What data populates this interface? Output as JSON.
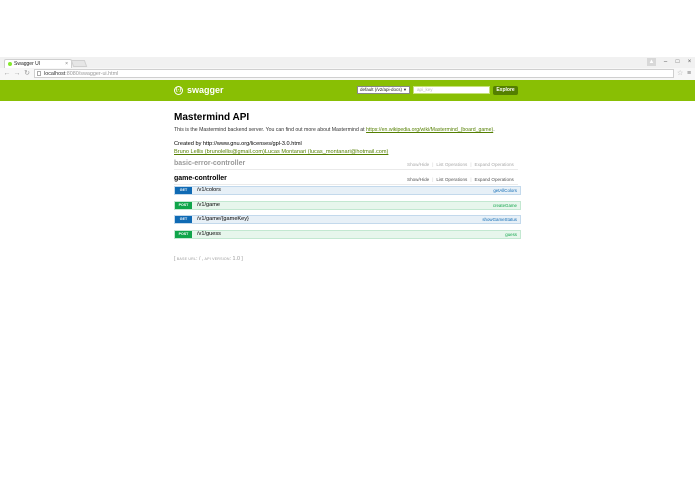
{
  "browser": {
    "tab_title": "Swagger UI",
    "tab_close": "×",
    "url_host": "localhost",
    "url_rest": ":8080/swagger-ui.html",
    "window_controls": {
      "minimize": "–",
      "maximize": "□",
      "close": "×"
    }
  },
  "header": {
    "logo_symbol": "{-}",
    "logo_text": "swagger",
    "spec_select": "default (/v2/api-docs)",
    "api_key_placeholder": "api_key",
    "explore_label": "Explore",
    "color": "#89bf04"
  },
  "info": {
    "title": "Mastermind API",
    "description_prefix": "This is the Mastermind backend server. You can find out more about Mastermind at ",
    "description_link": "https://en.wikipedia.org/wiki/Mastermind_(board_game)",
    "description_suffix": ".",
    "created_by": "Created by http://www.gnu.org/licenses/gpl-3.0.html",
    "contact_1": "Bruno Lellis (brunolellis@gmail.com)",
    "contact_2": "Lucas Montanari (lucas_montanari@hotmail.com)"
  },
  "resources": [
    {
      "name": "basic-error-controller",
      "show_hide": "Show/Hide",
      "list_operations": "List Operations",
      "expand_operations": "Expand Operations"
    },
    {
      "name": "game-controller",
      "show_hide": "Show/Hide",
      "list_operations": "List Operations",
      "expand_operations": "Expand Operations",
      "operations": [
        {
          "method": "GET",
          "path": "/v1/colors",
          "nickname": "getAllColors"
        },
        {
          "method": "POST",
          "path": "/v1/game",
          "nickname": "createGame"
        },
        {
          "method": "GET",
          "path": "/v1/game/{gameKey}",
          "nickname": "showGameStatus"
        },
        {
          "method": "POST",
          "path": "/v1/guess",
          "nickname": "guess"
        }
      ]
    }
  ],
  "footer": {
    "base_url_label": "BASE URL",
    "base_url": "/",
    "api_version_label": "API VERSION",
    "api_version": "1.0"
  },
  "colors": {
    "get": "#0f6ab4",
    "post": "#10a54a",
    "link": "#547f00"
  }
}
